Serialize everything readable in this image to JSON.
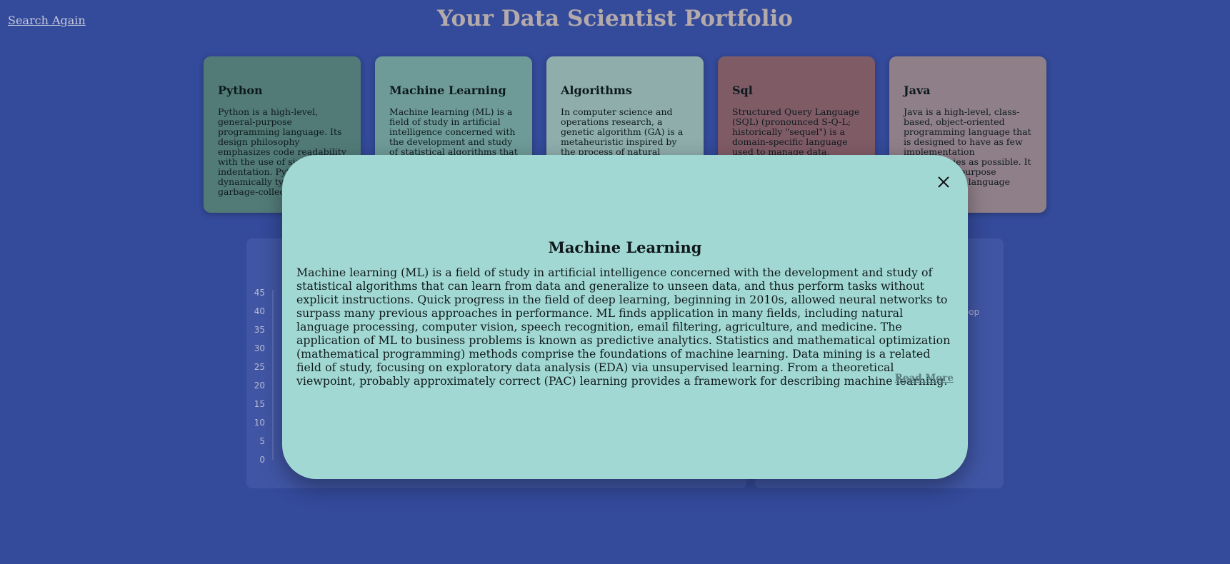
{
  "header": {
    "search_again": "Search Again",
    "title": "Your Data Scientist Portfolio"
  },
  "cards": [
    {
      "title": "Python",
      "text": "Python is a high-level, general-purpose programming language. Its design philosophy emphasizes code readability with the use of significant indentation. Python is dynamically typed and garbage-collected...",
      "color": "#527b78"
    },
    {
      "title": "Machine Learning",
      "text": "Machine learning (ML) is a field of study in artificial intelligence concerned with the development and study of statistical algorithms that can learn from data and generalize to unseen data...",
      "color": "#6e9a98"
    },
    {
      "title": "Algorithms",
      "text": "In computer science and operations research, a genetic algorithm (GA) is a metaheuristic inspired by the process of natural selection that belongs to the larger class of evolutionary algorithms...",
      "color": "#8eadab"
    },
    {
      "title": "Sql",
      "text": "Structured Query Language (SQL) (pronounced S-Q-L; historically \"sequel\") is a domain-specific language used to manage data, especially in a relational database management system...",
      "color": "#7f5b66"
    },
    {
      "title": "Java",
      "text": "Java is a high-level, class-based, object-oriented programming language that is designed to have as few implementation dependencies as possible. It is a general-purpose programming language intended t...",
      "color": "#8f7f89"
    }
  ],
  "chart": {
    "y_ticks": [
      "45",
      "40",
      "35",
      "30",
      "25",
      "20",
      "15",
      "10",
      "5",
      "0"
    ]
  },
  "side_panel": {
    "legend_fragment": "oop"
  },
  "modal": {
    "title": "Machine Learning",
    "body": "Machine learning (ML) is a field of study in artificial intelligence concerned with the development and study of statistical algorithms that can learn from data and generalize to unseen data, and thus perform tasks without explicit instructions. Quick progress in the field of deep learning, beginning in 2010s, allowed neural networks to surpass many previous approaches in performance. ML finds application in many fields, including natural language processing, computer vision, speech recognition, email filtering, agriculture, and medicine. The application of ML to business problems is known as predictive analytics. Statistics and mathematical optimization (mathematical programming) methods comprise the foundations of machine learning. Data mining is a related field of study, focusing on exploratory data analysis (EDA) via unsupervised learning. From a theoretical viewpoint, probably approximately correct (PAC) learning provides a framework for describing machine learning.",
    "read_more": "Read More",
    "close_icon": "close-icon"
  }
}
